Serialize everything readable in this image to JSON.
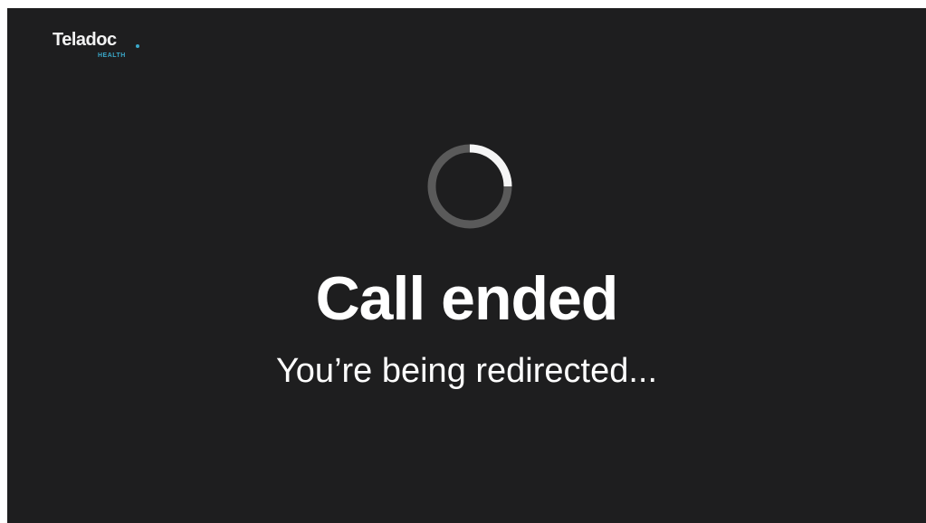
{
  "brand": {
    "name": "Teladoc",
    "sub": "HEALTH",
    "accent_color": "#3aa8c9"
  },
  "status": {
    "title": "Call ended",
    "message": "You’re being redirected..."
  },
  "spinner": {
    "icon": "loading-spinner-icon",
    "track_color": "#5a5a5a",
    "arc_color": "#f5f5f5"
  },
  "theme": {
    "background": "#1e1e1f",
    "text": "#ffffff"
  }
}
